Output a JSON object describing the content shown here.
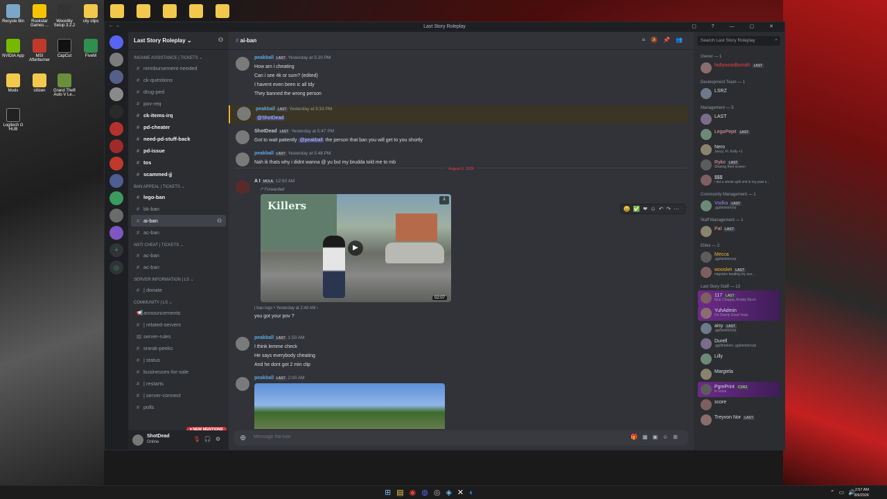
{
  "desktop": {
    "icons": [
      {
        "label": "Recycle Bin"
      },
      {
        "label": "Rockstar Games ..."
      },
      {
        "label": "Woordity Setup 3.2.2"
      },
      {
        "label": "city clips"
      },
      {
        "label": "NVIDIA App"
      },
      {
        "label": "MSI Afterburner"
      },
      {
        "label": "CapCut"
      },
      {
        "label": "FiveM"
      },
      {
        "label": "Mods"
      },
      {
        "label": "citizen"
      },
      {
        "label": "Grand Theft Auto V Le..."
      },
      {
        "label": "Logitech G HUB"
      }
    ]
  },
  "window": {
    "title": "Last Story Roleplay"
  },
  "server": {
    "name": "Last Story Roleplay ⌄"
  },
  "categories": {
    "ingame": "INGAME ASSISTANCE | TICKETS ⌄",
    "ban": "BAN APPEAL | TICKETS ⌄",
    "anticheat": "ANTI CHEAT | TICKETS ⌄",
    "serverinfo": "Server Information | LS ⌄",
    "community": "Community | LS ⌄"
  },
  "channels": {
    "ingame": [
      "reimbursement-needed",
      "ck-questions",
      "drug-ped",
      "pov-req",
      "ck-items-irq",
      "pd-cheater",
      "need-pd-stuff-back",
      "pd-issue",
      "tos",
      "scammed-jj"
    ],
    "ban": [
      "lego-ban",
      "bk-ban",
      "ai-ban",
      "ac-ban"
    ],
    "anticheat": [
      "ac-ban",
      "ac-ban"
    ],
    "serverinfo": [
      "| donate"
    ],
    "community": [
      "announcements",
      "| related-servers",
      "server-rules",
      "sneak-peeks",
      "| status",
      "businesses-for-sale",
      "| restarts",
      "| server-connect",
      "polls"
    ]
  },
  "new_mentions": "NEW MENTIONS",
  "user": {
    "name": "ShotDead",
    "status": "Online"
  },
  "channel": {
    "name": "ai-ban",
    "composer_placeholder": "Message #ai-ban"
  },
  "search_placeholder": "Search Last Story Roleplay",
  "messages": {
    "m1": {
      "author": "peakball",
      "tag": "LAST",
      "time": "Yesterday at 5:20 PM",
      "lines": [
        "How am i cheating",
        "Can i see 4k or sum? (edited)",
        "I havent even been ic all tdy",
        "They banned the wrong person"
      ]
    },
    "m2": {
      "author": "peakball",
      "tag": "LAST",
      "time": "Yesterday at 5:33 PM",
      "mention": "@ShotDead"
    },
    "m3": {
      "author": "ShotDead",
      "tag": "LAST",
      "time": "Yesterday at 5:47 PM",
      "pre": "Got to wait patiently",
      "mention": "@peakball",
      "post": "the person that ban you will get to you shortly"
    },
    "m4": {
      "author": "peakball",
      "tag": "LAST",
      "time": "Yesterday at 5:48 PM",
      "line": "Nah ik thats why i didnt wanna @ yu but my brudda told me to mb"
    },
    "date_divider": "August 9, 2026",
    "m5": {
      "author": "A I",
      "tag": "MOLA",
      "time": "12:50 AM",
      "forwarded": "Forwarded",
      "sign": "Killers",
      "duration": "02:07",
      "source": "| ban-logs • Yesterday at 2:48 AM ›",
      "line": "you got your pov ?"
    },
    "m6": {
      "author": "peakball",
      "tag": "LAST",
      "time": "1:50 AM",
      "lines": [
        "I think lemme check",
        "He says everybody cheating",
        "And he dont got 2 min clip"
      ]
    },
    "m7": {
      "author": "peakball",
      "tag": "LAST",
      "time": "2:00 AM"
    }
  },
  "members": {
    "groups": [
      {
        "title": "Owner — 1",
        "items": [
          {
            "name": "hollywoodbsmith",
            "sub": "",
            "tag": "LAST",
            "color": "#f23f43"
          }
        ]
      },
      {
        "title": "Development Team — 1",
        "items": [
          {
            "name": "LSRZ",
            "sub": "",
            "tag": "",
            "color": "#dbdee1"
          }
        ]
      },
      {
        "title": "Management — 5",
        "items": [
          {
            "name": "LAST",
            "sub": "",
            "tag": "",
            "color": "#dbdee1"
          },
          {
            "name": "LegoPepit",
            "sub": "",
            "tag": "LAST",
            "color": "#f0a1a1"
          },
          {
            "name": "Nero",
            "sub": "Jeezy, Ft. Kelly +1",
            "tag": "",
            "color": "#dbdee1"
          },
          {
            "name": "Ryko",
            "sub": "Sharing their screen",
            "tag": "LAST",
            "color": "#f0a1a1"
          },
          {
            "name": "$$$",
            "sub": "i did a whole split shit in my past s...",
            "tag": "",
            "color": "#dbdee1"
          }
        ]
      },
      {
        "title": "Community Management — 1",
        "items": [
          {
            "name": "Vodka",
            "sub": ".gg/laststoryrp",
            "tag": "LAST",
            "color": "#9b84ec"
          }
        ]
      },
      {
        "title": "Staff Management — 1",
        "items": [
          {
            "name": "Pal",
            "sub": "",
            "tag": "LAST",
            "color": "#f0a1a1"
          }
        ]
      },
      {
        "title": "Elites — 2",
        "items": [
          {
            "name": "Mecca",
            "sub": ".gg/laststoryrp",
            "tag": "",
            "color": "#f0b232"
          },
          {
            "name": "wooskei",
            "sub": "migraine beating my ass...",
            "tag": "LAST",
            "color": "#f0b232"
          }
        ]
      },
      {
        "title": "Last Story Staff — 13",
        "items": [
          {
            "name": "117",
            "sub": "NLE Choppa, Roddy Ricch",
            "tag": "LAST",
            "color": "#dbdee1"
          },
          {
            "name": "YuhAdmin",
            "sub": "I'm Overly Good Yeah",
            "tag": "",
            "color": "#dbdee1"
          },
          {
            "name": "aisy",
            "sub": ".gg/laststoryrp",
            "tag": "LAST",
            "color": "#dbdee1"
          },
          {
            "name": "Durell",
            "sub": ".gg/dirtakers .gg/laststoryrp",
            "tag": "",
            "color": "#dbdee1"
          },
          {
            "name": "Lilly",
            "sub": "",
            "tag": "",
            "color": "#dbdee1"
          },
          {
            "name": "Margiela",
            "sub": "",
            "tag": "",
            "color": "#dbdee1"
          },
          {
            "name": "PgmPrint",
            "sub": "In voice",
            "tag": "CSRZ",
            "color": "#dbdee1"
          },
          {
            "name": "score",
            "sub": "",
            "tag": "",
            "color": "#dbdee1"
          },
          {
            "name": "Treyvon Nor",
            "sub": "",
            "tag": "LAST",
            "color": "#dbdee1"
          }
        ]
      }
    ]
  },
  "taskbar": {
    "time": "2:57 AM",
    "date": "8/9/2026"
  },
  "colors": {
    "accent": "#5865f2",
    "mention_red": "#f23f43",
    "author_blue": "#5aa9e6"
  }
}
